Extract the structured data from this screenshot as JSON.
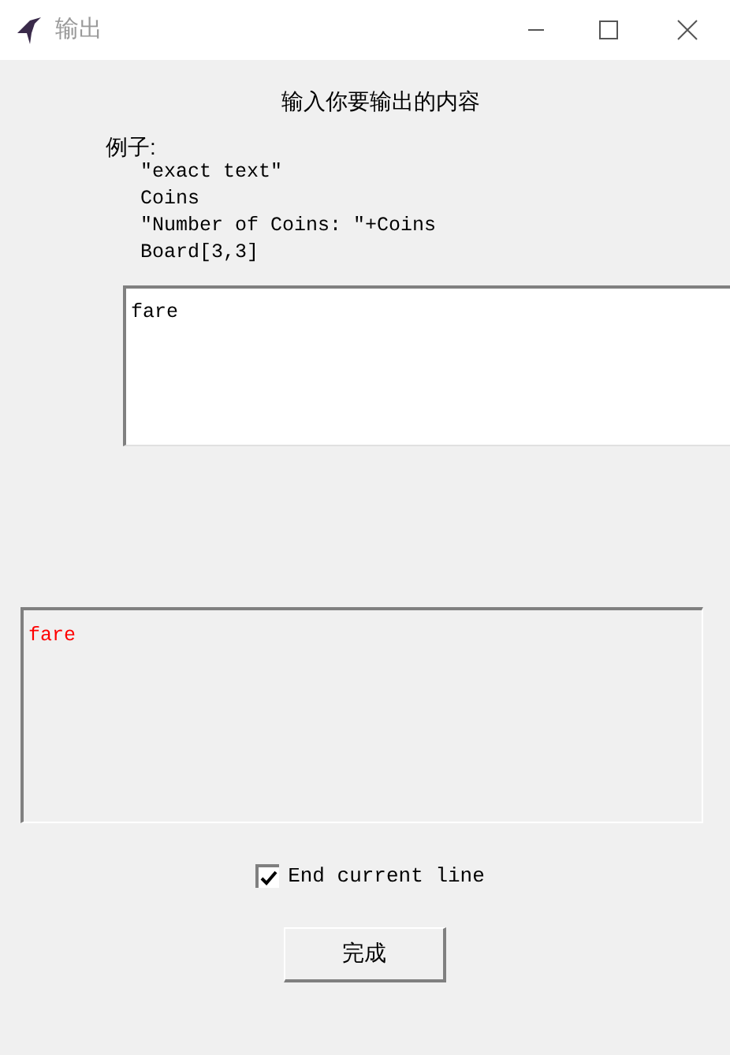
{
  "window": {
    "title": "输出"
  },
  "prompt": "输入你要输出的内容",
  "examples": {
    "label": "例子:",
    "lines": [
      "\"exact text\"",
      "Coins",
      "\"Number of Coins: \"+Coins",
      "Board[3,3]"
    ]
  },
  "input": {
    "value": "fare"
  },
  "output": {
    "text": "fare"
  },
  "checkbox": {
    "label": "End current line",
    "checked": true
  },
  "button": {
    "label": "完成"
  }
}
